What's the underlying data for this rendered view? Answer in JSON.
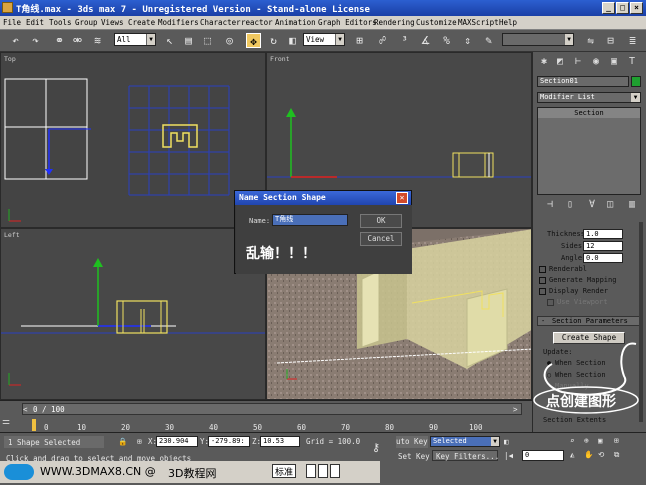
{
  "window": {
    "title": "T角线.max - 3ds max 7  - Unregistered Version - Stand-alone License",
    "min_label": "_",
    "max_label": "□",
    "close_label": "×"
  },
  "menu": [
    "File",
    "Edit",
    "Tools",
    "Group",
    "Views",
    "Create",
    "Modifiers",
    "Character",
    "reactor",
    "Animation",
    "Graph Editors",
    "Rendering",
    "Customize",
    "MAXScript",
    "Help"
  ],
  "toolbar": {
    "selection_filter": "All",
    "ref_coord": "View",
    "named_selection": ""
  },
  "viewports": {
    "top": {
      "label": "Top"
    },
    "front": {
      "label": "Front"
    },
    "left": {
      "label": "Left"
    },
    "perspective": {
      "label": ""
    }
  },
  "dialog": {
    "title": "Name Section Shape",
    "name_label": "Name:",
    "name_value": "T角线",
    "ok_label": "OK",
    "cancel_label": "Cancel",
    "annotation": "乱输！！！"
  },
  "command_panel": {
    "object_name": "Section01",
    "object_color": "#1fa030",
    "modifier_list": "Modifier List",
    "stack_item": "Section",
    "thickness_label": "Thickness:",
    "thickness_value": "1.0",
    "sides_label": "Sides:",
    "sides_value": "12",
    "angle_label": "Angle:",
    "angle_value": "0.0",
    "renderable": "Renderabl",
    "generate_mapping": "Generate Mapping",
    "display_render": "Display Render",
    "use_viewport": "Use Viewport",
    "rollout_title": "Section Parameters",
    "create_shape": "Create Shape",
    "update_label": "Update:",
    "when_section_moves": "When Section",
    "when_section_selected": "When Section",
    "manually": "Manually",
    "section_extents": "Section Extents",
    "annotation": "点创建图形"
  },
  "timeline": {
    "frame_display": "0 / 100",
    "ticks": [
      "0",
      "10",
      "20",
      "30",
      "40",
      "50",
      "60",
      "70",
      "80",
      "90",
      "100"
    ]
  },
  "status": {
    "selection_info": "1 Shape Selected",
    "prompt": "Click and drag to select and move objects",
    "x_label": "X:",
    "x_value": "230.904",
    "y_label": "Y:",
    "y_value": "-279.89:",
    "z_label": "Z:",
    "z_value": "10.53",
    "grid": "Grid = 100.0",
    "auto_key": "uto Key",
    "key_mode": "Selected",
    "set_key": "Set Key",
    "key_filters": "Key Filters...",
    "frame_value": "0",
    "ime_label": "标准"
  },
  "watermark": {
    "url": "WWW.3DMAX8.CN @",
    "site": "3D教程网"
  }
}
